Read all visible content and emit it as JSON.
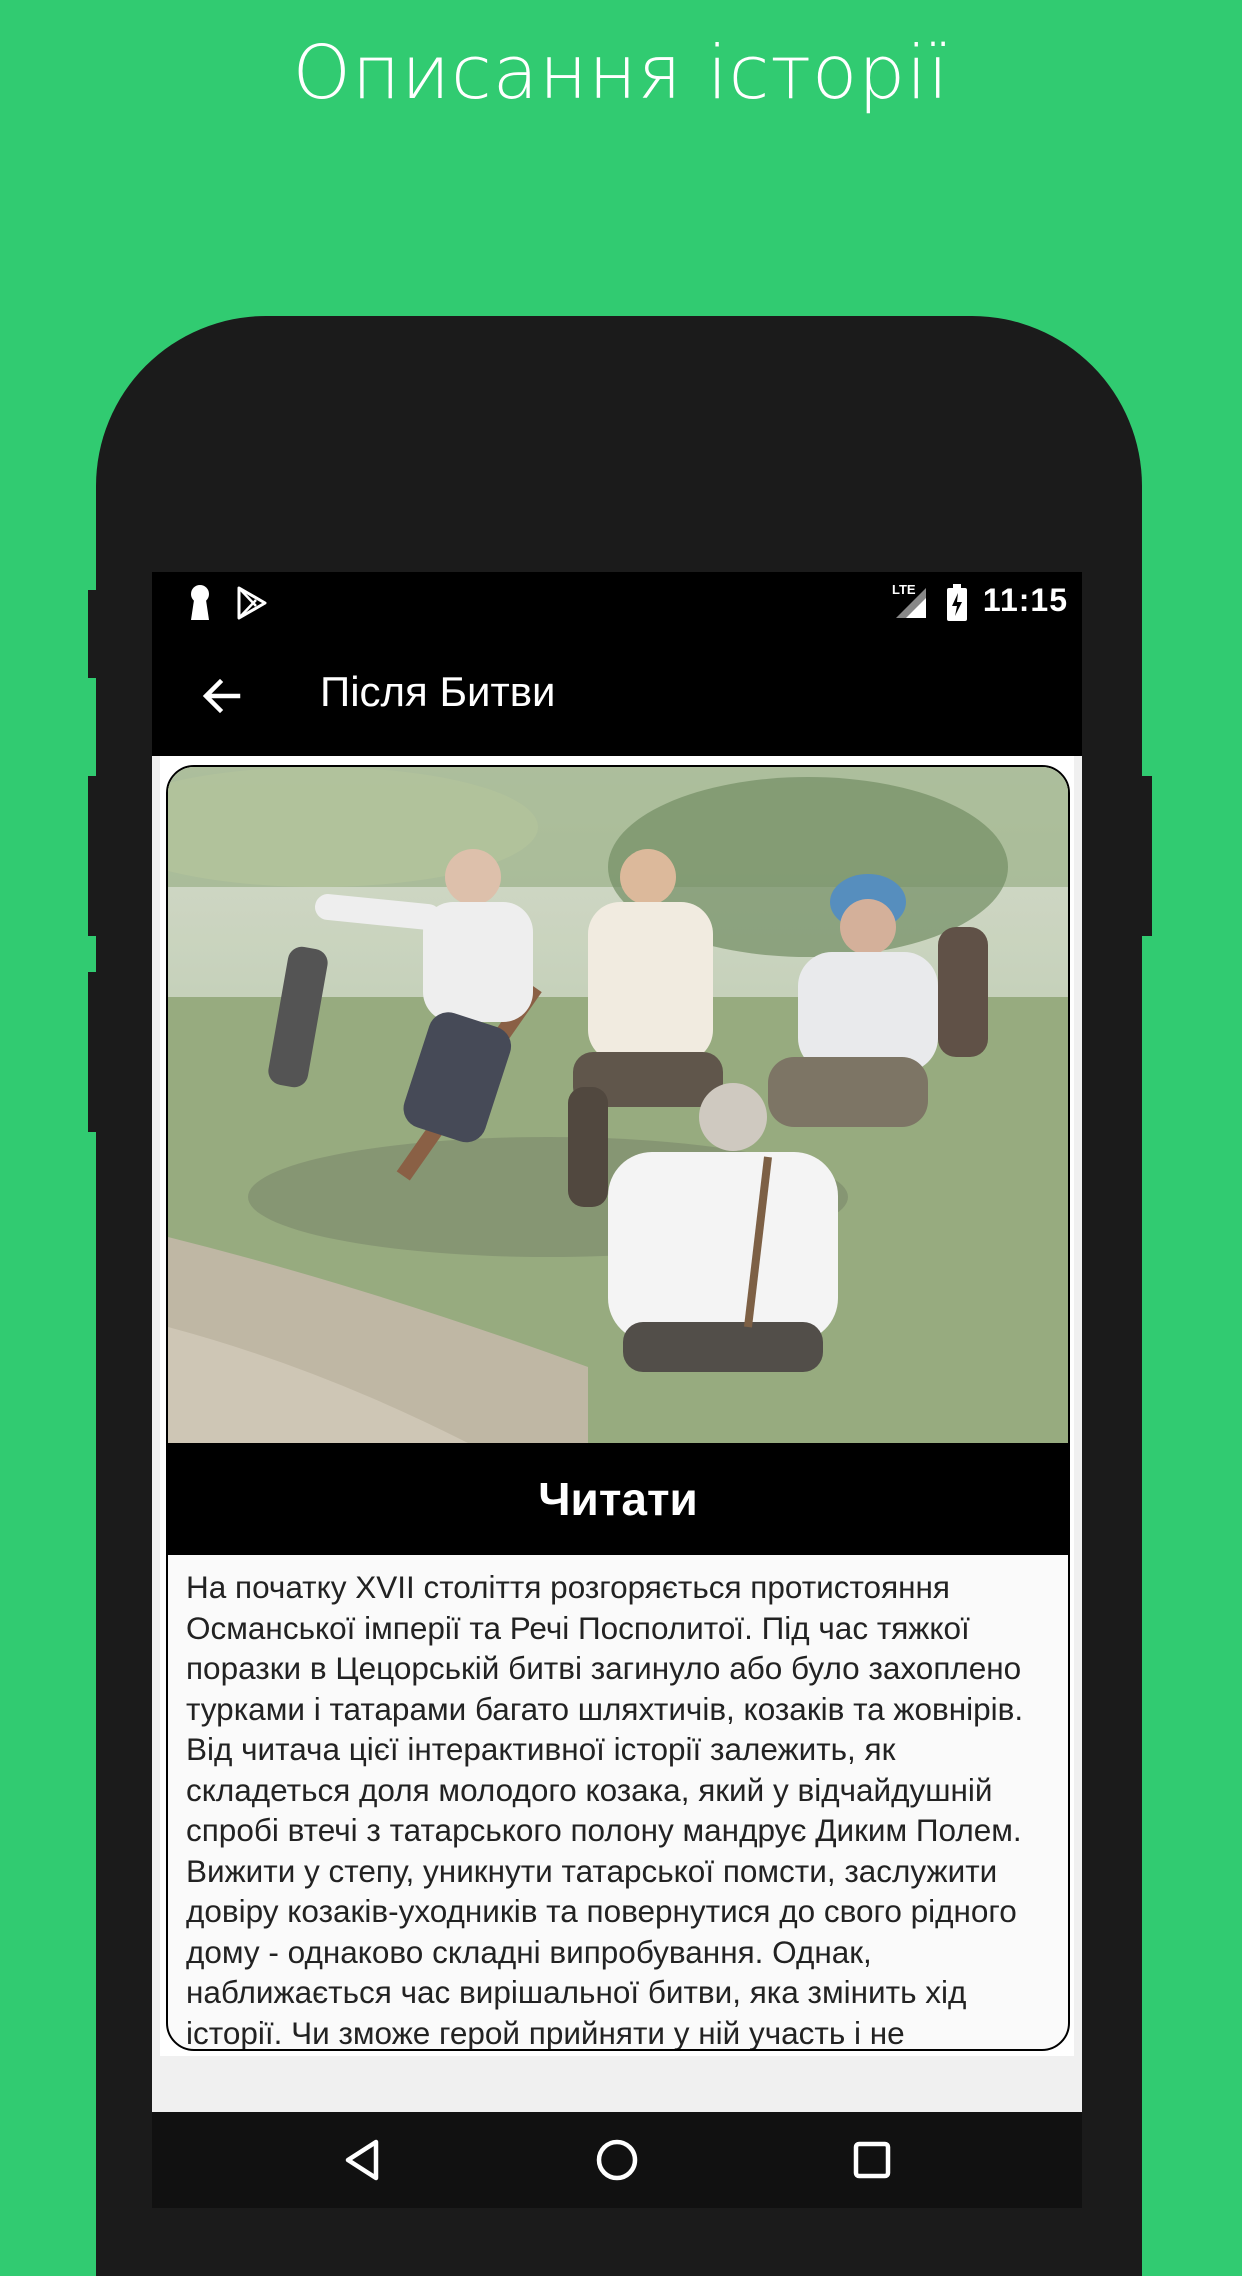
{
  "promo": {
    "title": "Описання історії"
  },
  "status_bar": {
    "time": "11:15",
    "network": "LTE"
  },
  "toolbar": {
    "title": "Після Битви",
    "back_icon": "arrow-left-icon"
  },
  "story": {
    "image_icon": "story-cover-photo",
    "read_label": "Читати",
    "description": "На початку XVII століття розгоряється протистояння Османської імперії та Речі Посполитої. Під час тяжкої поразки в Цецорській битві загинуло або було захоплено турками і татарами багато шляхтичів, козаків та жовнірів. Від читача цієї інтерактивної історії залежить, як складеться доля молодого козака, який у відчайдушній спробі втечі з татарського полону мандрує Диким Полем. Вижити у степу, уникнути татарської помсти, заслужити довіру козаків-уходників та повернутися до свого рідного дому - однаково складні випробування. Однак, наближається час вирішальної битви, яка змінить хід історії. Чи зможе герой прийняти у ній участь і не"
  },
  "nav": {
    "back_icon": "triangle-back-icon",
    "home_icon": "circle-home-icon",
    "recents_icon": "square-recents-icon"
  },
  "colors": {
    "background": "#31cb71",
    "phone": "#1b1b1b",
    "bar": "#000000"
  }
}
